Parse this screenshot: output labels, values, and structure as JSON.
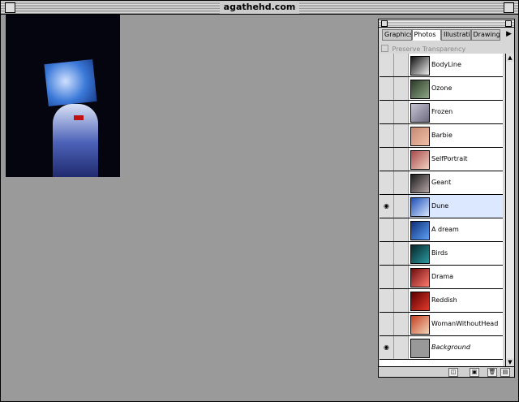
{
  "window": {
    "title": "agathehd.com"
  },
  "palette": {
    "tabs": [
      "Graphics",
      "Photos",
      "Illustrations",
      "Drawings"
    ],
    "preserve_label": "Preserve Transparency",
    "tab_arrow": "▶"
  },
  "layers": [
    {
      "name": "BodyLine",
      "visible": false,
      "colors": [
        "#111",
        "#eee"
      ]
    },
    {
      "name": "Ozone",
      "visible": false,
      "colors": [
        "#2b3b28",
        "#8da685"
      ]
    },
    {
      "name": "Frozen",
      "visible": false,
      "colors": [
        "#c7c5d4",
        "#6d6980"
      ]
    },
    {
      "name": "Barbie",
      "visible": false,
      "colors": [
        "#c48a72",
        "#f2c0a7"
      ]
    },
    {
      "name": "SelfPortrait",
      "visible": false,
      "colors": [
        "#a84b4b",
        "#f0d0c0"
      ]
    },
    {
      "name": "Geant",
      "visible": false,
      "colors": [
        "#1b1b1b",
        "#b5a4a4"
      ]
    },
    {
      "name": "Dune",
      "visible": true,
      "colors": [
        "#1e4fb8",
        "#d7e7ff"
      ]
    },
    {
      "name": "A dream",
      "visible": false,
      "colors": [
        "#0e2f78",
        "#5ea0f6"
      ]
    },
    {
      "name": "Birds",
      "visible": false,
      "colors": [
        "#052428",
        "#2a9aa0"
      ]
    },
    {
      "name": "Drama",
      "visible": false,
      "colors": [
        "#6d0d0d",
        "#ff7a6f"
      ]
    },
    {
      "name": "Reddish",
      "visible": false,
      "colors": [
        "#5b0000",
        "#e23a2c"
      ]
    },
    {
      "name": "WomanWithoutHead",
      "visible": false,
      "colors": [
        "#c43f22",
        "#f4d5b8"
      ]
    },
    {
      "name": "Background",
      "visible": true,
      "colors": [
        "#999",
        "#999"
      ],
      "background": true
    }
  ]
}
